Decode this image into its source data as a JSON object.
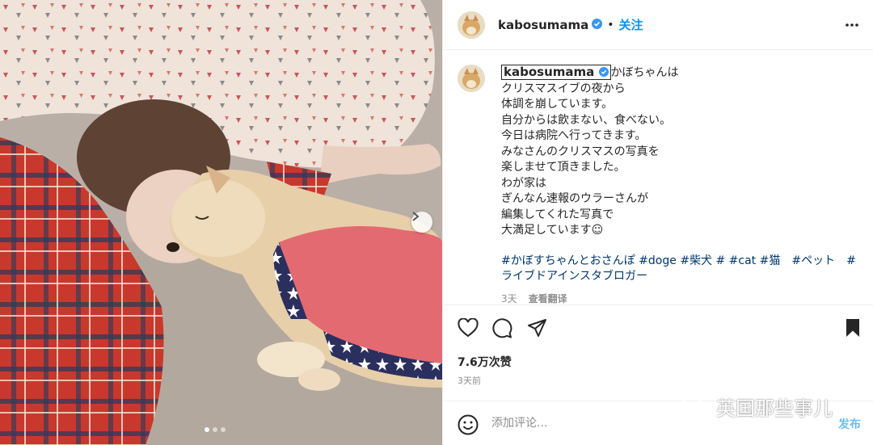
{
  "post": {
    "username": "kabosumama",
    "follow_label": "关注",
    "separator": "•"
  },
  "caption": {
    "username": "kabosumama",
    "lines": [
      "かぼちゃんは",
      "クリスマスイブの夜から",
      "体調を崩しています。",
      "自分からは飲まない、食べない。",
      "今日は病院へ行ってきます。",
      "みなさんのクリスマスの写真を",
      "楽しませて頂きました。",
      "わが家は",
      "ぎんなん速報のウラーさんが",
      "編集してくれた写真で",
      "大満足しています☺"
    ],
    "hashtags": [
      "#かぼすちゃんとおさんぽ #doge #柴犬 # #cat #猫　#ペット　#",
      "ライブドアインスタブロガー"
    ],
    "time": "3天",
    "translate_label": "查看翻译"
  },
  "engagement": {
    "likes": "7.6万次赞",
    "time_ago": "3天前"
  },
  "comment": {
    "placeholder": "添加评论...",
    "post_label": "发布"
  },
  "watermark": {
    "text": "英国那些事儿"
  },
  "carousel": {
    "count": 3,
    "active_index": 0
  },
  "colors": {
    "accent": "#0095f6",
    "verified": "#3897f0",
    "hashtag": "#00376b",
    "muted": "#8e8e8e"
  },
  "icons": [
    "verified-badge-icon",
    "more-options-icon",
    "heart-icon",
    "comment-icon",
    "share-icon",
    "bookmark-icon",
    "emoji-icon",
    "chevron-right-icon",
    "wechat-icon"
  ]
}
